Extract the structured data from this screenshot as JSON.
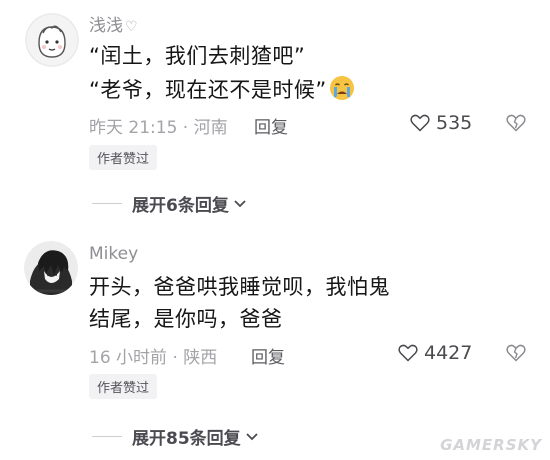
{
  "comments": [
    {
      "username": "浅浅",
      "username_suffix_icon": "heart-outline-icon",
      "lines": [
        "“闰土，我们去刺猹吧”",
        "“老爷，现在还不是时候”"
      ],
      "trailing_emoji": "crying-face-emoji",
      "meta": "昨天 21:15 · 河南",
      "reply_label": "回复",
      "likes": "535",
      "badge": "作者赞过",
      "expand_label": "展开6条回复"
    },
    {
      "username": "Mikey",
      "lines": [
        "开头，爸爸哄我睡觉呗，我怕鬼",
        "结尾，是你吗，爸爸"
      ],
      "meta": "16 小时前 · 陕西",
      "reply_label": "回复",
      "likes": "4427",
      "badge": "作者赞过",
      "expand_label": "展开85条回复"
    }
  ],
  "watermark": "GAMERSKY",
  "colors": {
    "meta": "#a3a3a8",
    "badge_bg": "#f2f2f4",
    "emoji_face": "#f6c343",
    "emoji_tear": "#5aa9e6"
  }
}
